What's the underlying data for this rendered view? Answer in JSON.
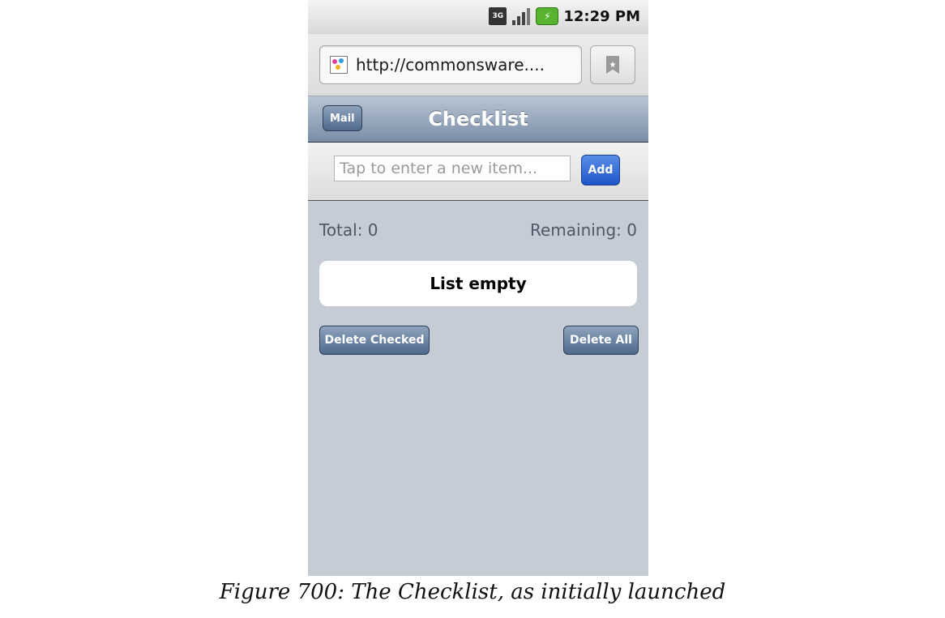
{
  "status_bar": {
    "network_label": "3G",
    "icons": [
      "network-3g-icon",
      "signal-strength-icon",
      "battery-charging-icon"
    ],
    "time": "12:29 PM"
  },
  "browser": {
    "url": "http://commonsware....",
    "bookmark_icon": "bookmark-star-icon"
  },
  "header": {
    "back_button": "Mail",
    "title": "Checklist"
  },
  "entry": {
    "placeholder": "Tap to enter a new item...",
    "value": "",
    "add_label": "Add"
  },
  "summary": {
    "total": "Total: 0",
    "remaining": "Remaining: 0"
  },
  "list": {
    "empty_message": "List empty"
  },
  "actions": {
    "delete_checked": "Delete Checked",
    "delete_all": "Delete All"
  },
  "caption": "Figure 700: The Checklist, as initially launched",
  "colors": {
    "app_background": "#c5ccd6",
    "toolbar": "#7a8ea8",
    "add_button": "#1f55c8",
    "battery": "#58b330"
  }
}
